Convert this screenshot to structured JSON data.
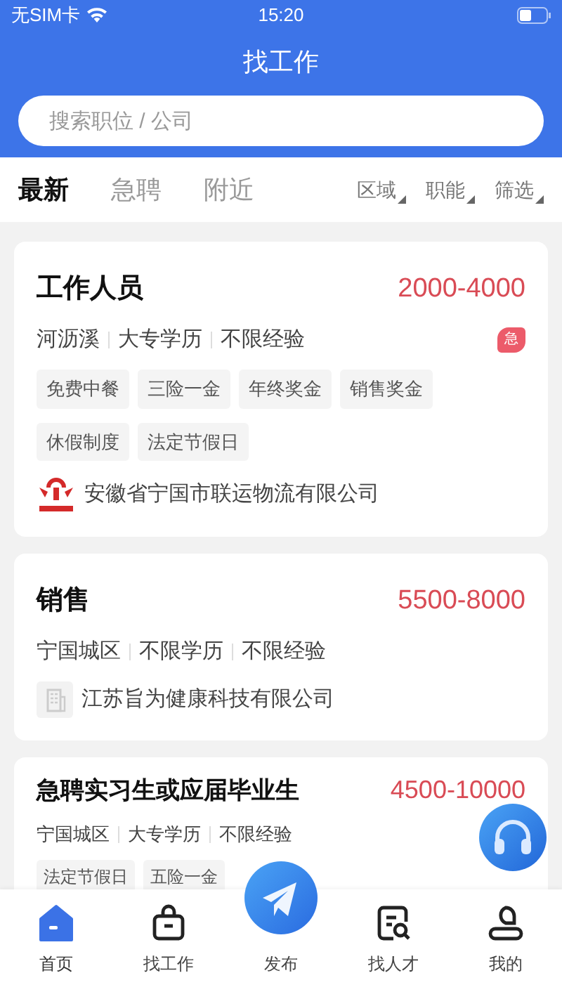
{
  "status_bar": {
    "carrier": "无SIM卡",
    "time": "15:20"
  },
  "header": {
    "title": "找工作"
  },
  "search": {
    "placeholder": "搜索职位 / 公司"
  },
  "tabs": [
    {
      "label": "最新",
      "selected": true
    },
    {
      "label": "急聘",
      "selected": false
    },
    {
      "label": "附近",
      "selected": false
    }
  ],
  "filters": [
    "区域",
    "职能",
    "筛选"
  ],
  "jobs": [
    {
      "kind": "full",
      "title": "工作人员",
      "salary": "2000-4000",
      "meta": [
        "河沥溪",
        "大专学历",
        "不限经验"
      ],
      "urgent": true,
      "urgent_label": "急",
      "tags": [
        "免费中餐",
        "三险一金",
        "年终奖金",
        "销售奖金",
        "休假制度",
        "法定节假日"
      ],
      "company": {
        "kind": "emblem",
        "name": "安徽省宁国市联运物流有限公司"
      }
    },
    {
      "kind": "full",
      "title": "销售",
      "salary": "5500-8000",
      "meta": [
        "宁国城区",
        "不限学历",
        "不限经验"
      ],
      "urgent": false,
      "company": {
        "kind": "building",
        "name": "江苏旨为健康科技有限公司"
      }
    },
    {
      "kind": "compact",
      "title": "急聘实习生或应届毕业生",
      "salary": "4500-10000",
      "meta": [
        "宁国城区",
        "大专学历",
        "不限经验"
      ],
      "urgent": false,
      "tags": [
        "法定节假日",
        "五险一金"
      ]
    }
  ],
  "nav": [
    {
      "label": "首页",
      "kind": "home",
      "selected": true
    },
    {
      "label": "找工作",
      "kind": "bag",
      "selected": false
    },
    {
      "label": "发布",
      "kind": "publish",
      "selected": false
    },
    {
      "label": "找人才",
      "kind": "resume",
      "selected": false
    },
    {
      "label": "我的",
      "kind": "person",
      "selected": false
    }
  ]
}
